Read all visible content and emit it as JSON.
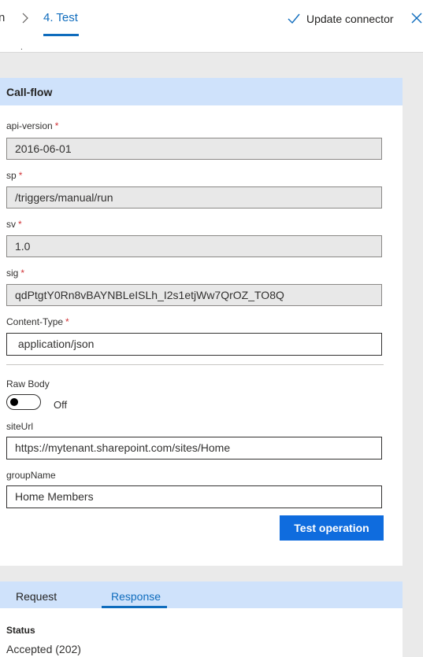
{
  "header": {
    "prev_step": "n",
    "active_step": "4. Test",
    "update_label": "Update connector"
  },
  "subbar": {
    "mark": "."
  },
  "callflow": {
    "title": "Call-flow",
    "required_mark": "*",
    "fields": [
      {
        "label": "api-version",
        "value": "2016-06-01",
        "required": true,
        "disabled": true
      },
      {
        "label": "sp",
        "value": "/triggers/manual/run",
        "required": true,
        "disabled": true
      },
      {
        "label": "sv",
        "value": "1.0",
        "required": true,
        "disabled": true
      },
      {
        "label": "sig",
        "value": "qdPtgtY0Rn8vBAYNBLeISLh_I2s1etjWw7QrOZ_TO8Q",
        "required": true,
        "disabled": true
      },
      {
        "label": "Content-Type",
        "value": " application/json",
        "required": true,
        "disabled": false
      }
    ],
    "raw_body": {
      "label": "Raw Body",
      "state": "Off"
    },
    "site_url": {
      "label": "siteUrl",
      "value": "https://mytenant.sharepoint.com/sites/Home"
    },
    "group_name": {
      "label": "groupName",
      "value": "Home Members"
    },
    "test_button": "Test operation"
  },
  "result": {
    "tabs": [
      "Request",
      "Response"
    ],
    "active_tab": "Response",
    "status_label": "Status",
    "status_value": "Accepted (202)"
  },
  "colors": {
    "accent": "#0f6cbd",
    "button": "#0f6cde",
    "header_band": "#cfe2fb",
    "required": "#d13438"
  }
}
